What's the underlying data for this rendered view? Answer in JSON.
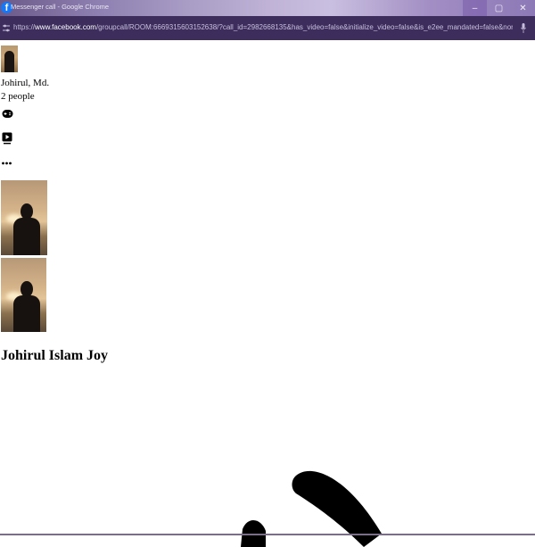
{
  "window": {
    "title": "Messenger call - Google Chrome",
    "buttons": {
      "minimize": "–",
      "maximize": "▢",
      "close": "✕"
    },
    "icon": "facebook-logo"
  },
  "address_bar": {
    "scheme": "https://",
    "host": "www.facebook.com",
    "path": "/groupcall/ROOM:6669315603152638/?call_id=2982668135&has_video=false&initialize_video=false&is_e2ee_mandated=false&nonce=7vwmilxgeka39&referrer_cont..."
  },
  "call": {
    "participant_short_name": "Johirul, Md.",
    "participants_count": "2 people",
    "full_name": "Johirul Islam Joy"
  },
  "icons": [
    "gamepad-icon",
    "video-play-icon",
    "more-options-icon",
    "microphone-icon",
    "site-settings-icon"
  ],
  "colors": {
    "titlebar": "#8d7fb0",
    "addressbar": "#3c2d5c",
    "facebook_blue": "#1877f2"
  }
}
